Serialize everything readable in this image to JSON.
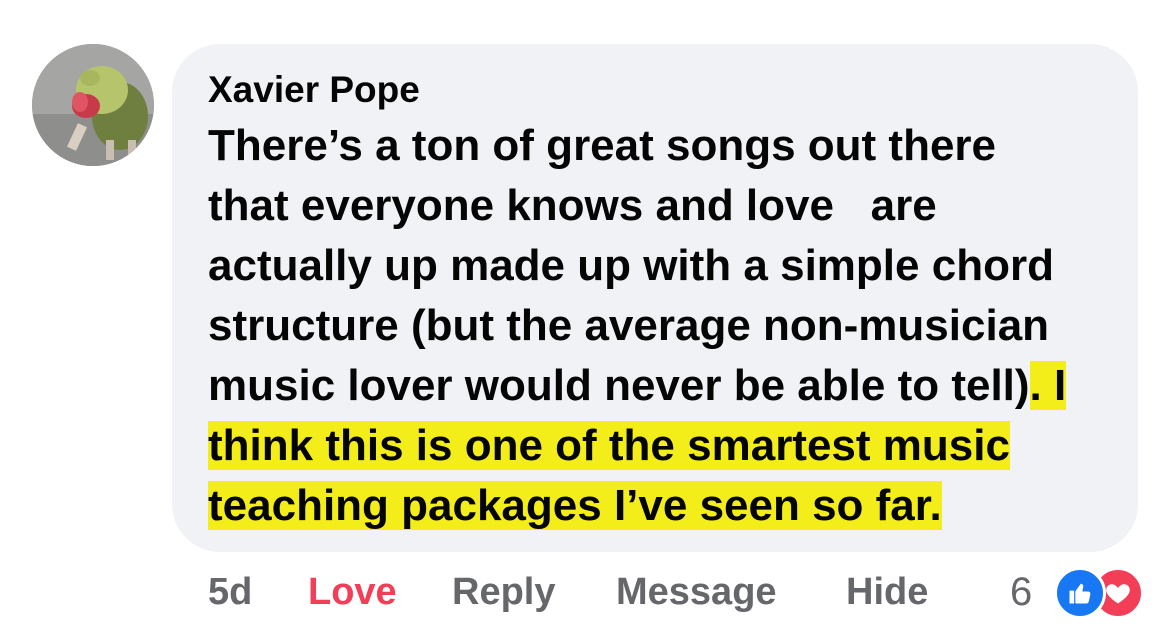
{
  "comment": {
    "author": "Xavier Pope",
    "body_lines": [
      {
        "plain": "There’s a ton of great songs out there",
        "highlight": ""
      },
      {
        "plain": "that everyone knows and love   are",
        "highlight": ""
      },
      {
        "plain": "actually up made up with a simple chord",
        "highlight": ""
      },
      {
        "plain": "structure (but the average non-musician",
        "highlight": ""
      },
      {
        "plain": "music lover would never be able to tell)",
        "highlight": ". I"
      },
      {
        "plain": "",
        "highlight": "think this is one of the smartest music"
      },
      {
        "plain": "",
        "highlight": "teaching packages I’ve seen so far."
      }
    ],
    "highlight_color": "#f3ee19"
  },
  "actions": {
    "time": "5d",
    "love_label": "Love",
    "reply_label": "Reply",
    "message_label": "Message",
    "hide_label": "Hide"
  },
  "reactions": {
    "count": "6",
    "icons": [
      "like-icon",
      "heart-icon"
    ],
    "like_color": "#1877f2",
    "heart_color": "#f33e58"
  },
  "colors": {
    "bubble_bg": "#f0f2f5",
    "text": "#050505",
    "secondary_text": "#65676b",
    "love_active": "#f33e58"
  }
}
